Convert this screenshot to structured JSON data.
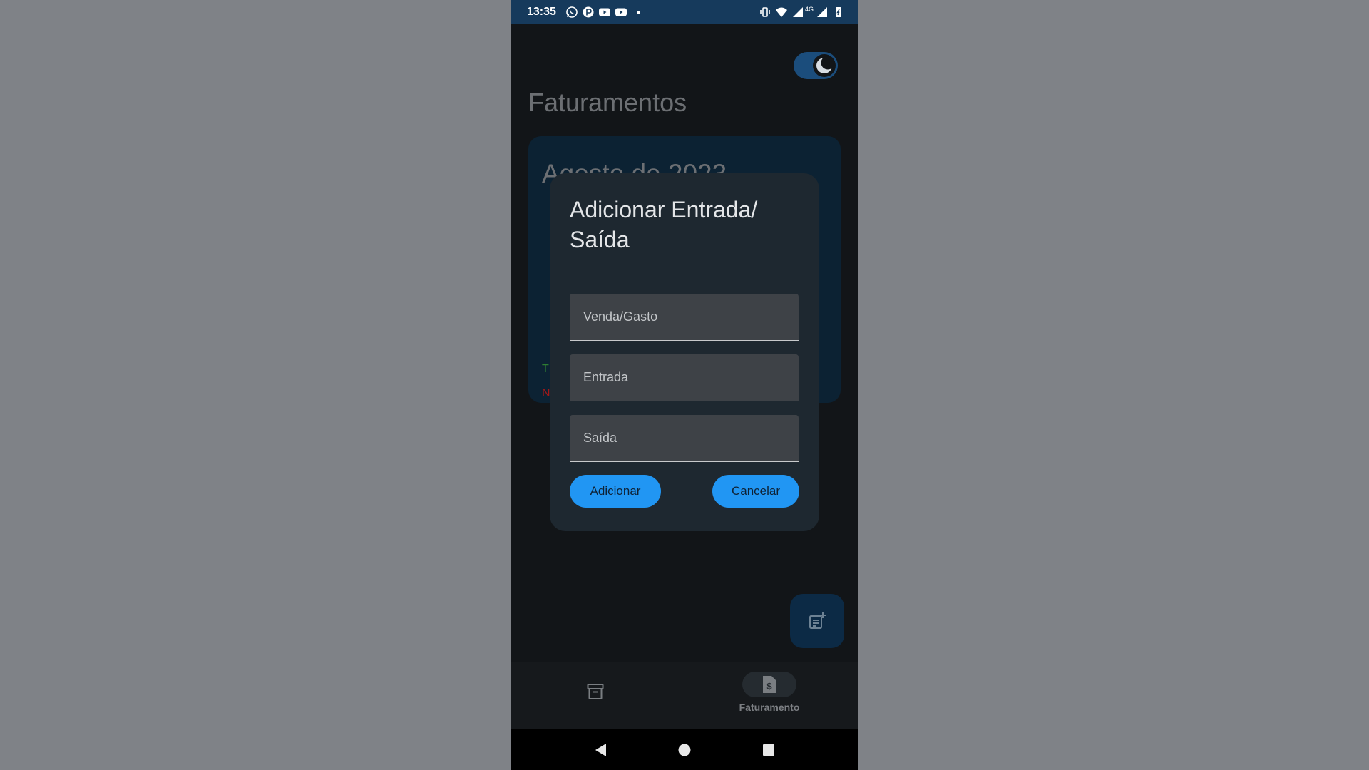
{
  "status_bar": {
    "time": "13:35",
    "network_type": "4G"
  },
  "app": {
    "page_title": "Faturamentos",
    "month_card": {
      "title": "Agosto de 2023",
      "partial_text": [
        "T",
        "N"
      ],
      "partial_colors": [
        "#2e7d32",
        "#a01818"
      ]
    },
    "fab": {
      "icon": "add-note-icon"
    },
    "bottom_nav": {
      "items": [
        {
          "icon": "archive-icon",
          "label": ""
        },
        {
          "icon": "dollar-document-icon",
          "label": "Faturamento",
          "active": true
        }
      ]
    }
  },
  "dialog": {
    "title": "Adicionar Entrada/ Saída",
    "fields": [
      {
        "placeholder": "Venda/Gasto",
        "value": ""
      },
      {
        "placeholder": "Entrada",
        "value": ""
      },
      {
        "placeholder": "Saída",
        "value": ""
      }
    ],
    "add_label": "Adicionar",
    "cancel_label": "Cancelar"
  },
  "colors": {
    "accent": "#2196f3",
    "status_bar": "#163a5c",
    "dialog_bg": "#1e2830"
  }
}
